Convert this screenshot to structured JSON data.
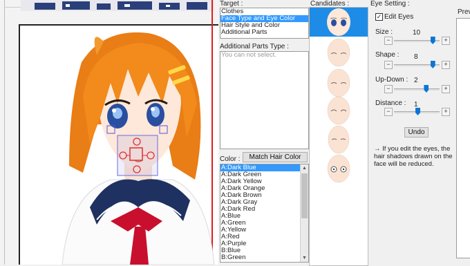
{
  "target": {
    "label": "Target :",
    "items": [
      "Clothes",
      "Face Type and Eye Color",
      "Hair Style and Color",
      "Additional Parts"
    ],
    "selected_index": 1
  },
  "additional_parts": {
    "label": "Additional Parts Type :",
    "placeholder": "You can not select."
  },
  "color": {
    "label": "Color :",
    "match_button": "Match Hair Color",
    "items": [
      "A:Dark Blue",
      "A:Dark Green",
      "A:Dark Yellow",
      "A:Dark Orange",
      "A:Dark Brown",
      "A:Dark Gray",
      "A:Dark Red",
      "A:Blue",
      "A:Green",
      "A:Yellow",
      "A:Red",
      "A:Purple",
      "B:Blue",
      "B:Green"
    ],
    "selected_index": 0
  },
  "candidates": {
    "label": "Candidates :",
    "count": 6,
    "selected_index": 0
  },
  "eye_setting": {
    "label": "Eye Setting :",
    "edit_eyes_label": "Edit Eyes",
    "edit_eyes_checked": true,
    "sliders": [
      {
        "name": "Size :",
        "value": "10",
        "level": 0.85
      },
      {
        "name": "Shape :",
        "value": "8",
        "level": 0.85
      },
      {
        "name": "Up-Down :",
        "value": "2",
        "level": 0.7
      },
      {
        "name": "Distance :",
        "value": "1",
        "level": 0.5
      }
    ],
    "undo": "Undo",
    "note": "→ If you edit the eyes, the hair shadows drawn on the face will be reduced."
  },
  "preview": {
    "label": "Prev"
  },
  "colors": {
    "selection": "#3399ff",
    "candidate_selected": "#1e8ce6",
    "slider_knob": "#0a76d6",
    "hair": "#f28a1c",
    "uniform_collar": "#1f3160",
    "tie": "#c8102e"
  }
}
